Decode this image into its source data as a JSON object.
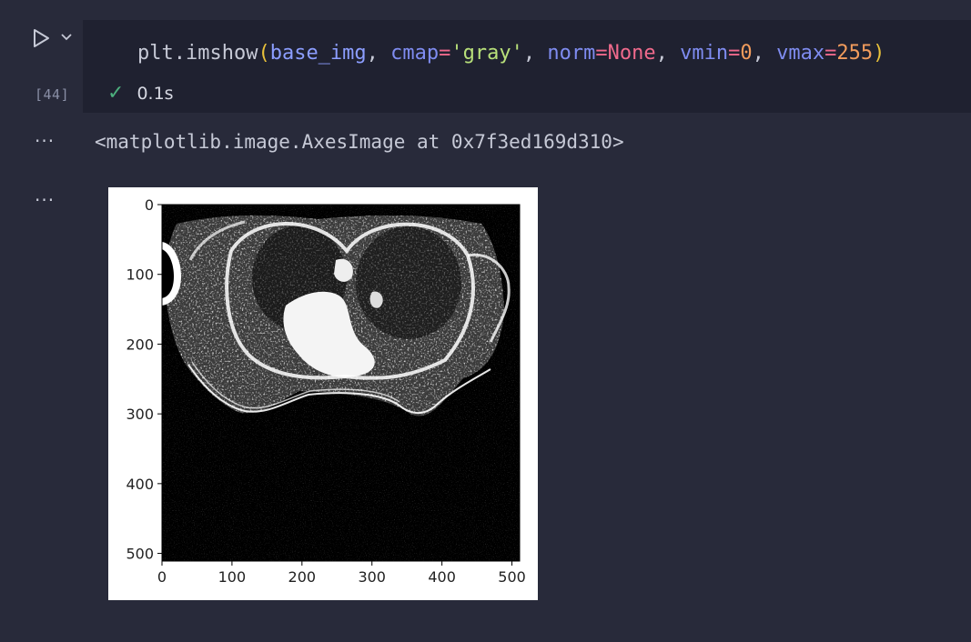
{
  "cell": {
    "execution_count": "[44]",
    "code": {
      "fn": "plt.imshow",
      "open_paren": "(",
      "arg1": "base_img",
      "comma": ", ",
      "kw_cmap": "cmap",
      "eq": "=",
      "val_cmap": "'gray'",
      "kw_norm": "norm",
      "val_norm": "None",
      "kw_vmin": "vmin",
      "val_vmin": "0",
      "kw_vmax": "vmax",
      "val_vmax": "255",
      "close_paren": ")"
    },
    "status": {
      "check": "✓",
      "duration": "0.1s"
    }
  },
  "output": {
    "more_1": "···",
    "more_2": "···",
    "repr_text": "<matplotlib.image.AxesImage at 0x7f3ed169d310>"
  },
  "chart_data": {
    "type": "heatmap",
    "cmap": "gray",
    "xticks": [
      "0",
      "100",
      "200",
      "300",
      "400",
      "500"
    ],
    "yticks": [
      "0",
      "100",
      "200",
      "300",
      "400",
      "500"
    ],
    "xlim": [
      0,
      511
    ],
    "ylim": [
      511,
      0
    ],
    "vmin": 0,
    "vmax": 255
  },
  "colors": {
    "background": "#282a3a",
    "code_bg": "#1f2130",
    "check_green": "#4caf7d"
  },
  "icons": {
    "run": "play-icon",
    "expand": "chevron-down-icon"
  }
}
